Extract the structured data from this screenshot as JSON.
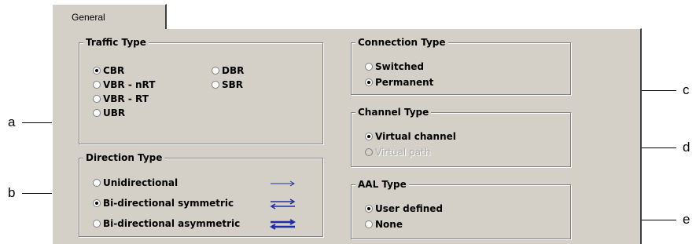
{
  "tab": {
    "label": "General"
  },
  "traffic": {
    "title": "Traffic Type",
    "cbr": "CBR",
    "vbr_nrt": "VBR - nRT",
    "vbr_rt": "VBR - RT",
    "ubr": "UBR",
    "dbr": "DBR",
    "sbr": "SBR",
    "selected": "CBR"
  },
  "direction": {
    "title": "Direction Type",
    "uni": "Unidirectional",
    "bi_sym": "Bi-directional symmetric",
    "bi_asym": "Bi-directional asymmetric",
    "selected": "Bi-directional symmetric",
    "arrow_color": "#1f2ea0"
  },
  "connection": {
    "title": "Connection Type",
    "switched": "Switched",
    "permanent": "Permanent",
    "selected": "Permanent"
  },
  "channel": {
    "title": "Channel Type",
    "virtual_channel": "Virtual channel",
    "virtual_path": "Virtual path",
    "selected": "Virtual channel"
  },
  "aal": {
    "title": "AAL Type",
    "user_defined": "User defined",
    "none": "None",
    "selected": "User defined"
  },
  "callouts": {
    "a": "a",
    "b": "b",
    "c": "c",
    "d": "d",
    "e": "e"
  }
}
